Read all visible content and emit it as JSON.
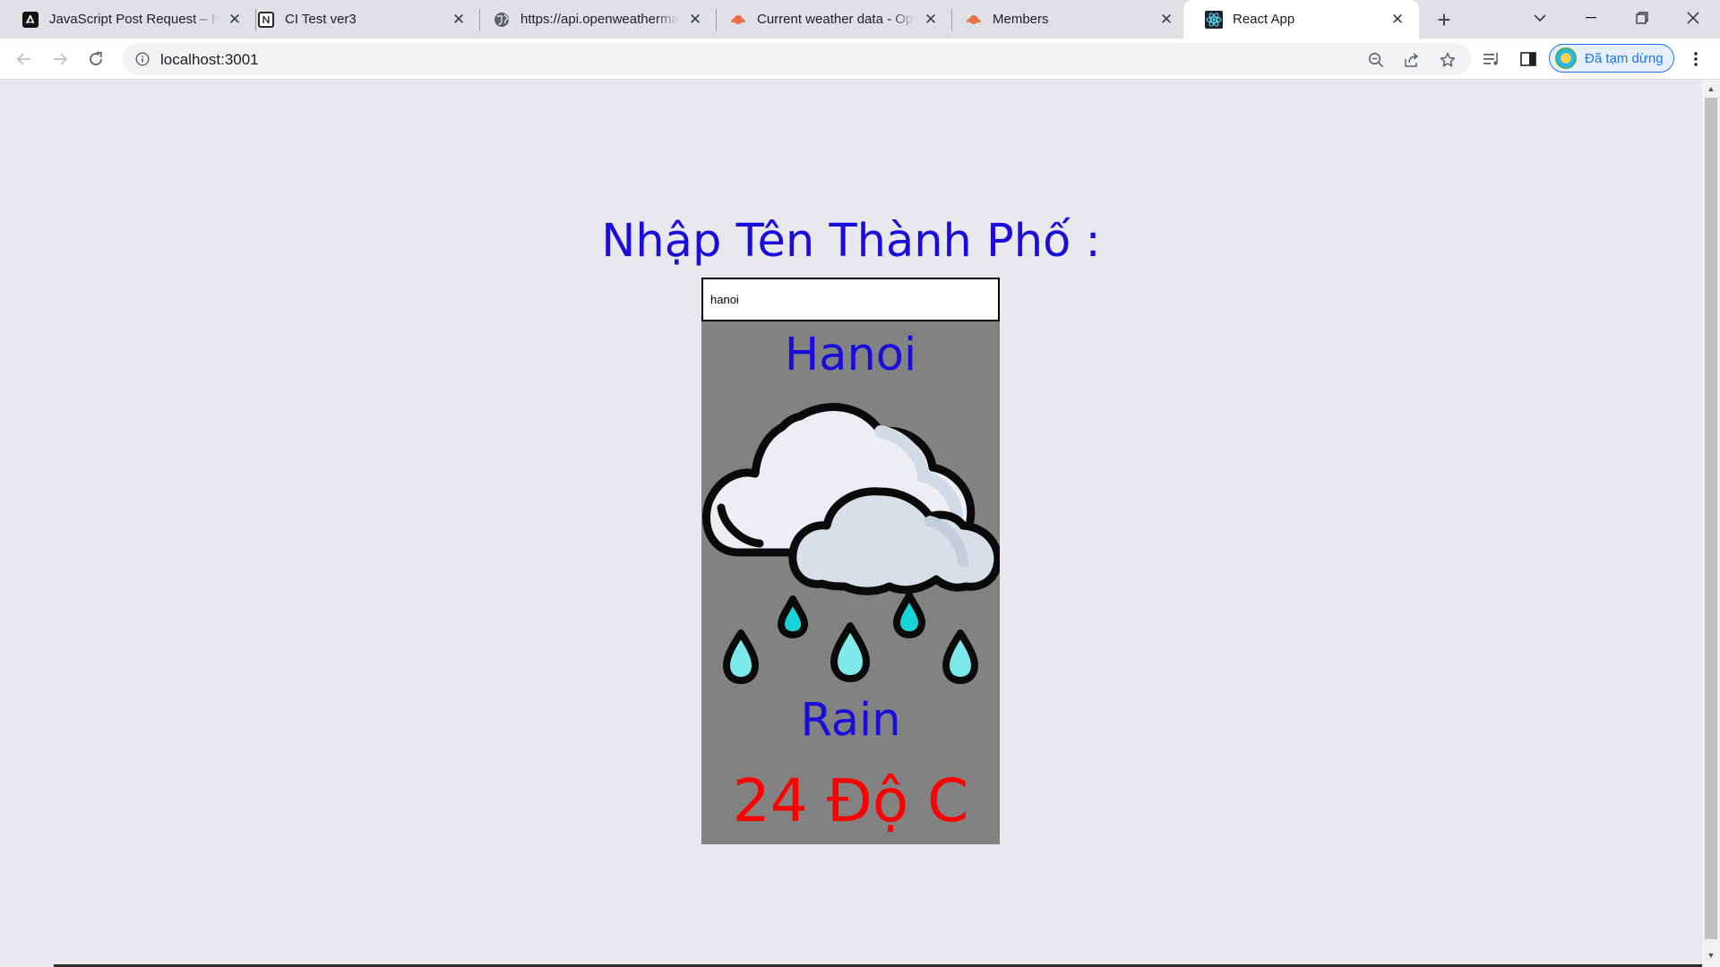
{
  "browser": {
    "tabs": [
      {
        "title": "JavaScript Post Request – H",
        "icon": "dev-logo-icon",
        "active": false
      },
      {
        "title": "CI Test ver3",
        "icon": "notion-icon",
        "active": false
      },
      {
        "title": "https://api.openweathermap",
        "icon": "globe-icon",
        "active": false
      },
      {
        "title": "Current weather data - Ope",
        "icon": "openweather-icon",
        "active": false
      },
      {
        "title": "Members",
        "icon": "openweather-icon",
        "active": false
      },
      {
        "title": "React App",
        "icon": "react-icon",
        "active": true
      }
    ],
    "new_tab_label": "+",
    "address": "localhost:3001",
    "profile_label": "Đã tạm dừng",
    "colors": {
      "tabstrip": "#dfe1e5",
      "toolbar": "#ffffff",
      "profile_accent": "#1a73e8"
    }
  },
  "page": {
    "heading": "Nhập Tên Thành Phố :",
    "search": {
      "value": "hanoi",
      "placeholder": ""
    },
    "weather": {
      "city": "Hanoi",
      "icon": "rain-cloud-icon",
      "description": "Rain",
      "temperature": "24 Độ C"
    },
    "colors": {
      "background": "#e9e8ec",
      "card": "#828282",
      "heading_text": "#1a0cdb",
      "temperature_text": "#ff0000"
    }
  }
}
